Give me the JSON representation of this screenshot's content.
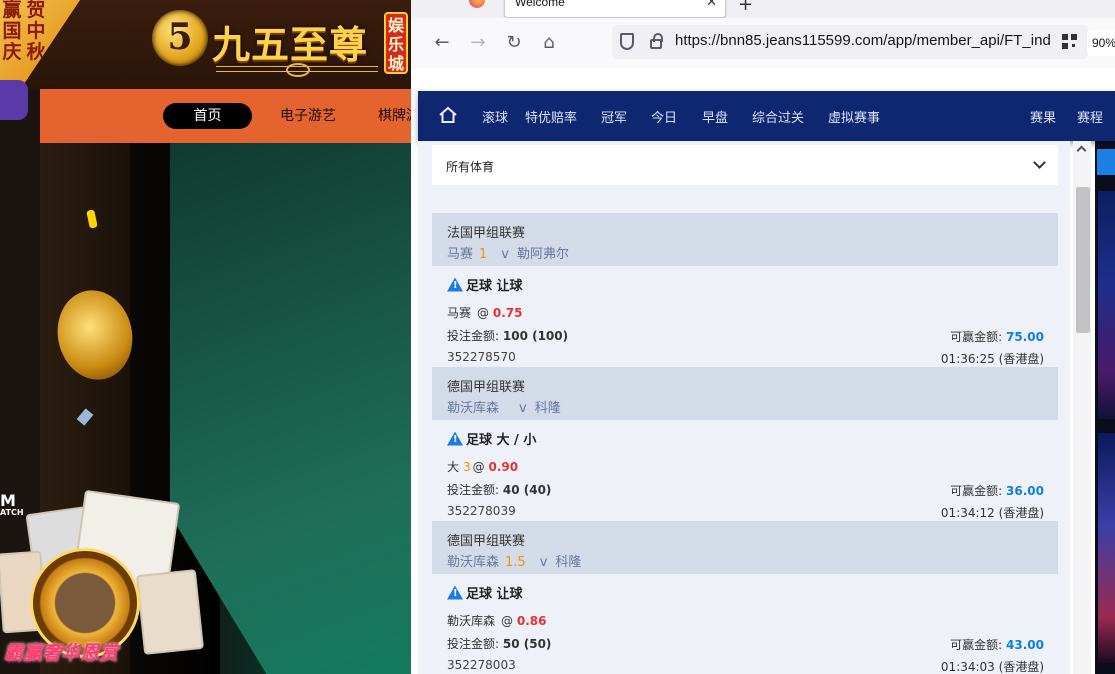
{
  "left_site": {
    "promo_chars": [
      "赢",
      "贺",
      "国",
      "中",
      "庆",
      "秋"
    ],
    "logo_number": "5",
    "logo_text": "九五至尊",
    "logo_badge": [
      "娱",
      "乐",
      "城"
    ],
    "nav": [
      {
        "label": "首页",
        "active": true
      },
      {
        "label": "电子游艺",
        "active": false
      },
      {
        "label": "棋牌游",
        "active": false
      }
    ],
    "watermark_main": "M",
    "watermark_sub": "ATCH",
    "game_banner": "霸赢奢华恩赏"
  },
  "browser": {
    "tab_title": "Welcome",
    "url": "https://bnn85.jeans115599.com/app/member_api/FT_ind",
    "zoom": "90%",
    "buttons": {
      "back": "←",
      "forward": "→",
      "reload": "↻",
      "home": "⌂",
      "new_tab": "+",
      "close_tab": "✕"
    }
  },
  "page": {
    "nav": [
      "滚球",
      "特优赔率",
      "冠军",
      "今日",
      "早盘",
      "综合过关",
      "虚拟赛事"
    ],
    "nav_right": [
      "赛果",
      "赛程"
    ],
    "filter_label": "所有体育",
    "bets": [
      {
        "league": "法国甲组联赛",
        "home": "马赛",
        "handicap": "1",
        "vs": "v",
        "away": "勒阿弗尔",
        "bet_type": "足球 让球",
        "selection": "马赛",
        "line": "",
        "at": "@",
        "odds": "0.75",
        "stake_label": "投注金额:",
        "stake": "100 (100)",
        "win_label": "可赢金额:",
        "win": "75.00",
        "ticket_id": "352278570",
        "time": "01:36:25 (香港盘)"
      },
      {
        "league": "德国甲组联赛",
        "home": "勒沃库森",
        "handicap": "",
        "vs": "v",
        "away": "科隆",
        "bet_type": "足球 大 / 小",
        "selection": "大",
        "line": "3",
        "at": "@",
        "odds": "0.90",
        "stake_label": "投注金额:",
        "stake": "40 (40)",
        "win_label": "可赢金额:",
        "win": "36.00",
        "ticket_id": "352278039",
        "time": "01:34:12 (香港盘)"
      },
      {
        "league": "德国甲组联赛",
        "home": "勒沃库森",
        "handicap": "1.5",
        "vs": "v",
        "away": "科隆",
        "bet_type": "足球 让球",
        "selection": "勒沃库森",
        "line": "",
        "at": "@",
        "odds": "0.86",
        "stake_label": "投注金额:",
        "stake": "50 (50)",
        "win_label": "可赢金额:",
        "win": "43.00",
        "ticket_id": "352278003",
        "time": "01:34:03 (香港盘)"
      }
    ]
  },
  "colors": {
    "site_nav_bg": "#0f2670",
    "league_header_bg": "#d3dbe9",
    "odds_red": "#e3342f",
    "handicap_orange": "#f39200",
    "win_blue": "#0e7ee0",
    "casino_nav_orange": "#e4632e"
  },
  "icons": {
    "home": "home-icon",
    "warning": "warning-icon",
    "shield": "shield-icon",
    "lock": "lock-icon",
    "qr": "qr-code-icon",
    "chevron": "chevron-down-icon",
    "browser": "firefox-icon"
  }
}
